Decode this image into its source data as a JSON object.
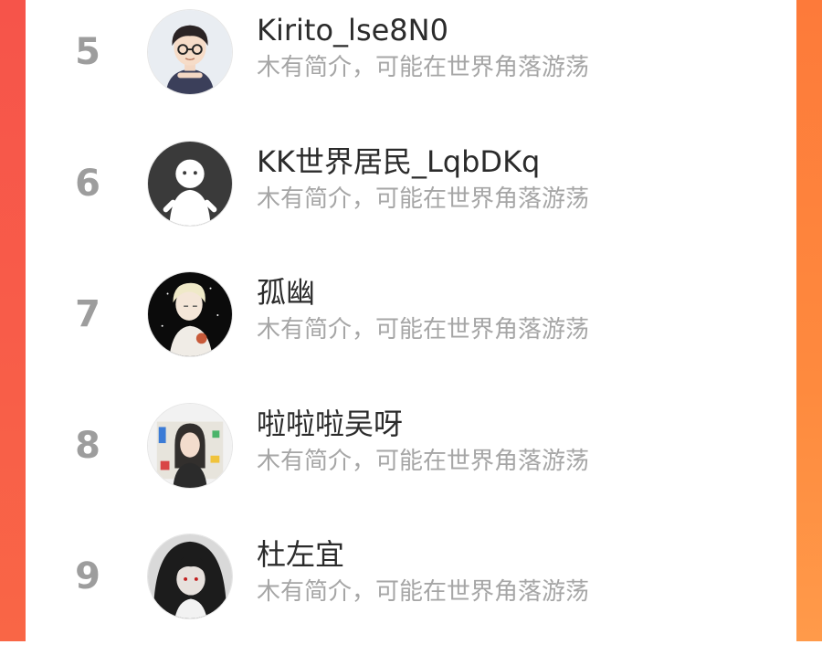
{
  "ranking": {
    "rows": [
      {
        "rank": "5",
        "name": "Kirito_lse8N0",
        "bio": "木有简介，可能在世界角落游荡",
        "avatar": "cartoon-boy-glasses-avatar"
      },
      {
        "rank": "6",
        "name": "KK世界居民_LqbDKq",
        "bio": "木有简介，可能在世界角落游荡",
        "avatar": "default-ghost-avatar"
      },
      {
        "rank": "7",
        "name": "孤幽",
        "bio": "木有简介，可能在世界角落游荡",
        "avatar": "anime-boy-dark-avatar"
      },
      {
        "rank": "8",
        "name": "啦啦啦吴呀",
        "bio": "木有简介，可能在世界角落游荡",
        "avatar": "girl-sticker-collage-avatar"
      },
      {
        "rank": "9",
        "name": "杜左宜",
        "bio": "木有简介，可能在世界角落游荡",
        "avatar": "anime-dark-hair-avatar"
      }
    ]
  },
  "colors": {
    "rank": "#9d9d9d",
    "name": "#2b2b2b",
    "bio": "#a6a6a6",
    "bg_left": "#f85c49",
    "bg_right": "#fe8a3e"
  }
}
